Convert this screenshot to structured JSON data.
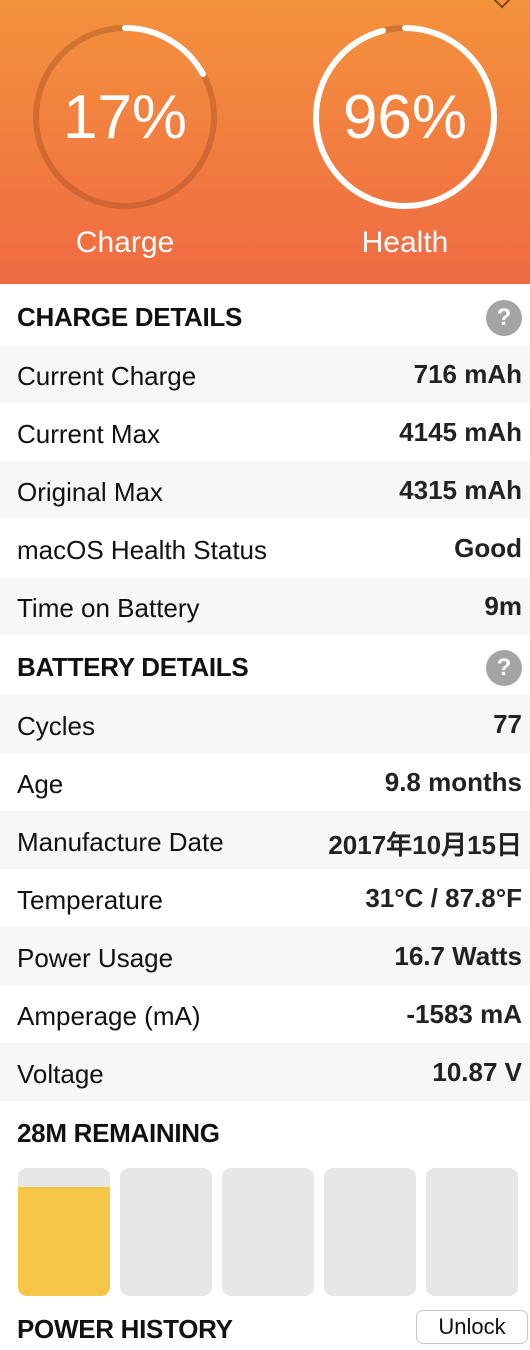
{
  "header": {
    "gradient_top": "#f4923c",
    "gradient_bottom": "#ef6a43",
    "gauges": [
      {
        "value": "17%",
        "label": "Charge",
        "level": 0.17
      },
      {
        "value": "96%",
        "label": "Health",
        "level": 0.96
      }
    ]
  },
  "charge_details": {
    "title": "CHARGE DETAILS",
    "help_label": "?",
    "rows": [
      {
        "label": "Current Charge",
        "value": "716 mAh"
      },
      {
        "label": "Current Max",
        "value": "4145 mAh"
      },
      {
        "label": "Original Max",
        "value": "4315 mAh"
      },
      {
        "label": "macOS Health Status",
        "value": "Good"
      },
      {
        "label": "Time on Battery",
        "value": "9m"
      }
    ]
  },
  "battery_details": {
    "title": "BATTERY DETAILS",
    "help_label": "?",
    "rows": [
      {
        "label": "Cycles",
        "value": "77"
      },
      {
        "label": "Age",
        "value": "9.8 months"
      },
      {
        "label": "Manufacture Date",
        "value": "2017年10月15日"
      },
      {
        "label": "Temperature",
        "value": "31°C / 87.8°F"
      },
      {
        "label": "Power Usage",
        "value": "16.7 Watts"
      },
      {
        "label": "Amperage (mA)",
        "value": "-1583 mA"
      },
      {
        "label": "Voltage",
        "value": "10.87 V"
      }
    ]
  },
  "remaining": {
    "title": "28M REMAINING",
    "fill_color": "#f6c646",
    "cells": [
      0.85,
      0,
      0,
      0,
      0
    ]
  },
  "power_history": {
    "title": "POWER HISTORY",
    "unlock_label": "Unlock"
  }
}
